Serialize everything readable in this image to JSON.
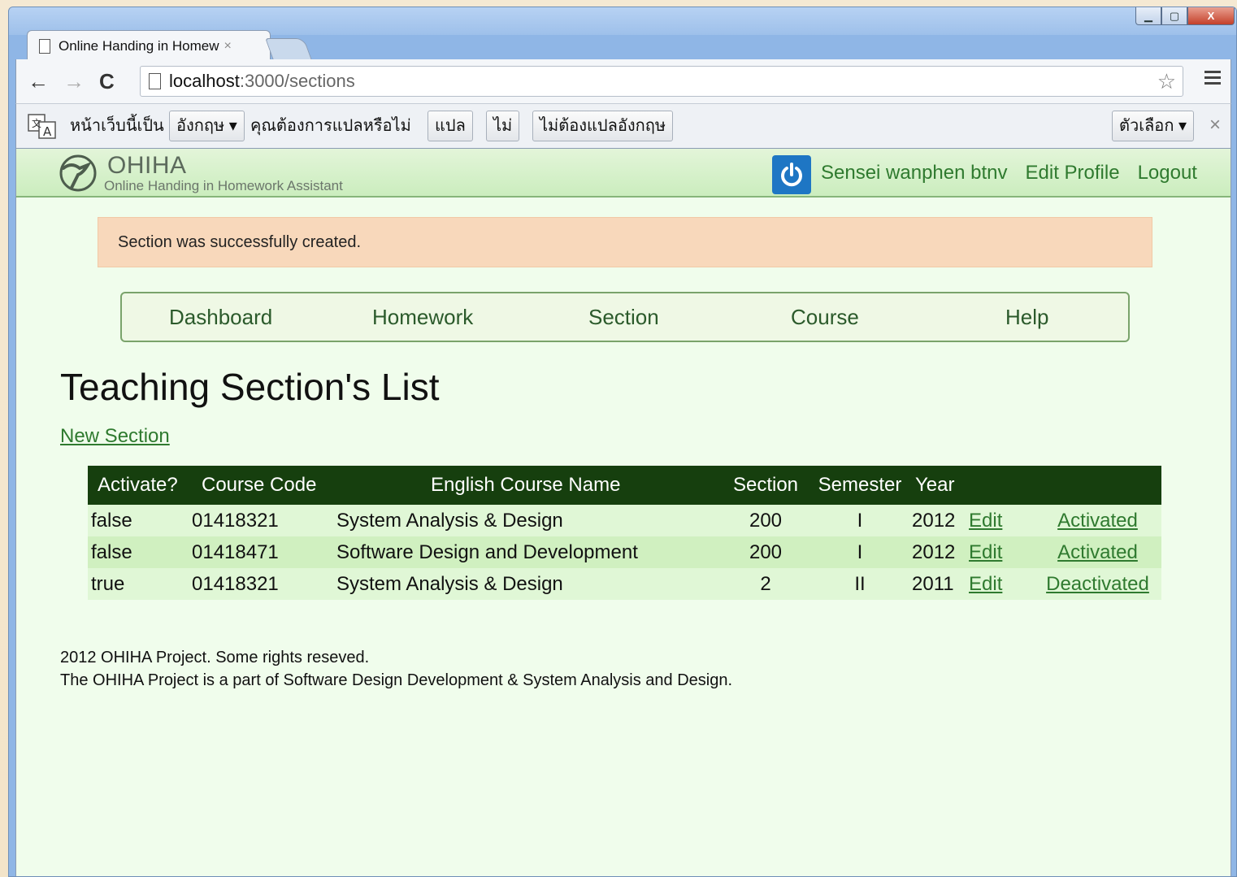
{
  "browser": {
    "tab_title": "Online Handing in Homew",
    "tab_close": "×",
    "url_host": "localhost",
    "url_path": ":3000/sections",
    "back": "←",
    "forward": "→",
    "reload": "C",
    "star": "☆"
  },
  "window_controls": {
    "minimize": "▁",
    "maximize": "▢",
    "close": "X"
  },
  "translate_bar": {
    "page_is_in": "หน้าเว็บนี้เป็น",
    "language": "อังกฤษ ▾",
    "question": "คุณต้องการแปลหรือไม่",
    "translate_button": "แปล",
    "no_button": "ไม่",
    "never_button": "ไม่ต้องแปลอังกฤษ",
    "options_button": "ตัวเลือก ▾",
    "close": "×"
  },
  "header": {
    "logo_title": "OHIHA",
    "logo_subtitle": "Online Handing in Homework Assistant",
    "user_name": "Sensei wanphen btnv",
    "edit_profile": "Edit Profile",
    "logout": "Logout"
  },
  "flash": {
    "message": "Section was successfully created."
  },
  "nav": {
    "dashboard": "Dashboard",
    "homework": "Homework",
    "section": "Section",
    "course": "Course",
    "help": "Help"
  },
  "main": {
    "title": "Teaching Section's List",
    "new_section": "New Section"
  },
  "table": {
    "headers": {
      "activate": "Activate?",
      "course_code": "Course Code",
      "course_name": "English Course Name",
      "section": "Section",
      "semester": "Semester",
      "year": "Year"
    },
    "rows": [
      {
        "activate": "false",
        "code": "01418321",
        "name": "System Analysis & Design",
        "section": "200",
        "semester": "I",
        "year": "2012",
        "edit": "Edit",
        "status": "Activated"
      },
      {
        "activate": "false",
        "code": "01418471",
        "name": "Software Design and Development",
        "section": "200",
        "semester": "I",
        "year": "2012",
        "edit": "Edit",
        "status": "Activated"
      },
      {
        "activate": "true",
        "code": "01418321",
        "name": "System Analysis & Design",
        "section": "2",
        "semester": "II",
        "year": "2011",
        "edit": "Edit",
        "status": "Deactivated"
      }
    ]
  },
  "footer": {
    "line1": "2012 OHIHA Project. Some rights reseved.",
    "line2": "The OHIHA Project is a part of Software Design Development & System Analysis and Design."
  },
  "colors": {
    "page_bg": "#f0fdec",
    "header_green": "#cbedbe",
    "table_header": "#163f0e",
    "link_green": "#2f7a2f",
    "flash_bg": "#f8d8bb",
    "power_blue": "#1e76c4"
  }
}
